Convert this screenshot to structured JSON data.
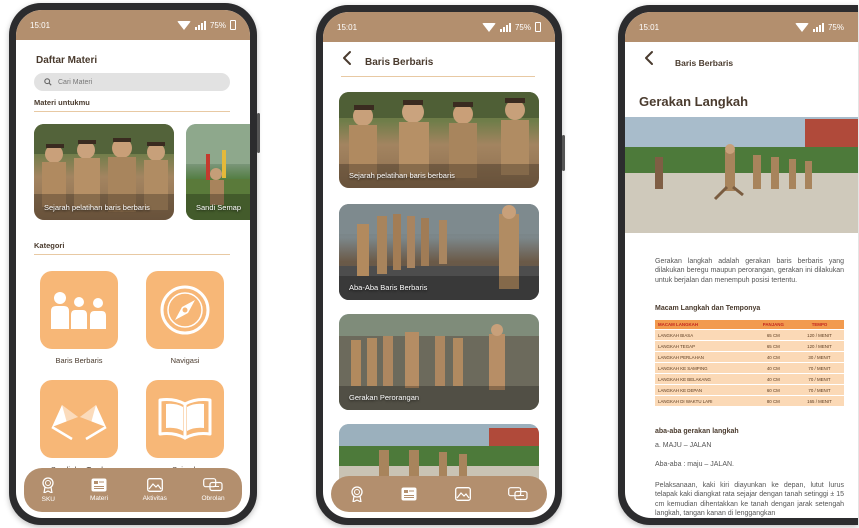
{
  "status": {
    "time": "15:01",
    "battery": "75%"
  },
  "screen1": {
    "title": "Daftar Materi",
    "search_placeholder": "Cari Materi",
    "section_for_you": "Materi untukmu",
    "cards": [
      {
        "caption": "Sejarah pelatihan baris berbaris"
      },
      {
        "caption": "Sandi Semap"
      }
    ],
    "section_category": "Kategori",
    "categories": [
      {
        "label": "Baris Berbaris",
        "icon": "people-icon"
      },
      {
        "label": "Navigasi",
        "icon": "compass-icon"
      },
      {
        "label": "Sandi dan Tanda",
        "icon": "flags-icon"
      },
      {
        "label": "Sejarah",
        "icon": "book-icon"
      }
    ]
  },
  "tabs": [
    {
      "label": "SKU",
      "icon": "medal-icon"
    },
    {
      "label": "Materi",
      "icon": "document-icon"
    },
    {
      "label": "Aktivitas",
      "icon": "image-icon"
    },
    {
      "label": "Obrolan",
      "icon": "chat-icon"
    }
  ],
  "screen2": {
    "title": "Baris Berbaris",
    "cards": [
      {
        "caption": "Sejarah pelatihan baris berbaris"
      },
      {
        "caption": "Aba-Aba Baris Berbaris"
      },
      {
        "caption": "Gerakan Perorangan"
      },
      {
        "caption": ""
      }
    ]
  },
  "screen3": {
    "back_title": "Baris Berbaris",
    "heading": "Gerakan Langkah",
    "intro": "Gerakan langkah adalah gerakan baris berbaris yang dilakukan beregu maupun perorangan, gerakan ini dilakukan untuk berjalan dan menempuh posisi tertentu.",
    "table_title": "Macam Langkah dan Temponya",
    "table_headers": [
      "MACAM LANGKAH",
      "PANJANG",
      "TEMPO"
    ],
    "table_rows": [
      [
        "LANGKAH BIASA",
        "65 CM",
        "120 / MENIT"
      ],
      [
        "LANGKAH TEGAP",
        "65 CM",
        "120 / MENIT"
      ],
      [
        "LANGKAH PERLAHAN",
        "40 CM",
        "30 / MENIT"
      ],
      [
        "LANGKAH KE SAMPING",
        "40 CM",
        "70 / MENIT"
      ],
      [
        "LANGKAH KE BELAKANG",
        "40 CM",
        "70 / MENIT"
      ],
      [
        "LANGKAH KE DEPAN",
        "60 CM",
        "70 / MENIT"
      ],
      [
        "LANGKAH DI WAKTU LARI",
        "80 CM",
        "165 / MENIT"
      ]
    ],
    "aba_title": "aba-aba gerakan langkah",
    "aba_a": "a. MAJU – JALAN",
    "aba_line": "Aba-aba : maju – JALAN.",
    "exec": "Pelaksanaan, kaki kiri diayunkan ke depan, lutut lurus telapak kaki diangkat rata sejajar dengan tanah setinggi ± 15 cm kemudian dihentakkan ke tanah dengan jarak setengah langkah, tangan kanan di lenggangkan"
  },
  "colors": {
    "brown": "#b38f6e",
    "orange": "#f7b777",
    "text": "#4a3b2e"
  }
}
